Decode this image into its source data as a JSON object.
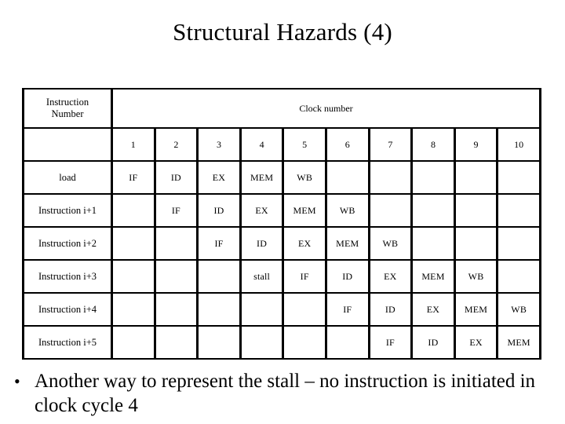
{
  "slide": {
    "title": "Structural Hazards (4)",
    "bullet_marker": "•",
    "bullet_text": "Another way to represent the stall – no instruction is initiated in clock cycle 4",
    "background_color": "#ffffff",
    "text_color": "#000000",
    "border_color": "#000000"
  },
  "table": {
    "header": {
      "instruction_label_line1": "Instruction",
      "instruction_label_line2": "Number",
      "clock_label": "Clock number"
    },
    "clock_numbers": [
      "1",
      "2",
      "3",
      "4",
      "5",
      "6",
      "7",
      "8",
      "9",
      "10"
    ],
    "rows": [
      {
        "label": "load",
        "cells": [
          "IF",
          "ID",
          "EX",
          "MEM",
          "WB",
          "",
          "",
          "",
          "",
          ""
        ]
      },
      {
        "label": "Instruction i+1",
        "cells": [
          "",
          "IF",
          "ID",
          "EX",
          "MEM",
          "WB",
          "",
          "",
          "",
          ""
        ]
      },
      {
        "label": "Instruction i+2",
        "cells": [
          "",
          "",
          "IF",
          "ID",
          "EX",
          "MEM",
          "WB",
          "",
          "",
          ""
        ]
      },
      {
        "label": "Instruction i+3",
        "cells": [
          "",
          "",
          "",
          "stall",
          "IF",
          "ID",
          "EX",
          "MEM",
          "WB",
          ""
        ]
      },
      {
        "label": "Instruction i+4",
        "cells": [
          "",
          "",
          "",
          "",
          "",
          "IF",
          "ID",
          "EX",
          "MEM",
          "WB"
        ]
      },
      {
        "label": "Instruction i+5",
        "cells": [
          "",
          "",
          "",
          "",
          "",
          "",
          "IF",
          "ID",
          "EX",
          "MEM"
        ]
      }
    ]
  }
}
